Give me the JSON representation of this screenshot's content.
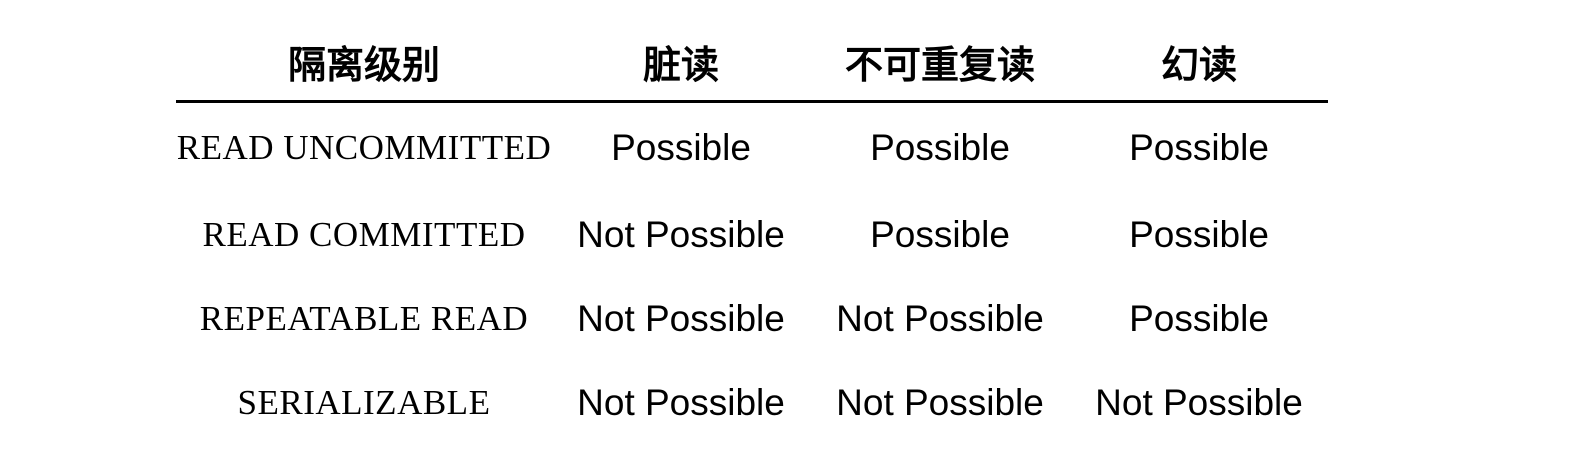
{
  "table": {
    "headers": [
      "隔离级别",
      "脏读",
      "不可重复读",
      "幻读"
    ],
    "rows": [
      [
        "READ UNCOMMITTED",
        "Possible",
        "Possible",
        "Possible"
      ],
      [
        "READ COMMITTED",
        "Not Possible",
        "Possible",
        "Possible"
      ],
      [
        "REPEATABLE READ",
        "Not Possible",
        "Not Possible",
        "Possible"
      ],
      [
        "SERIALIZABLE",
        "Not Possible",
        "Not Possible",
        "Not Possible"
      ]
    ]
  }
}
